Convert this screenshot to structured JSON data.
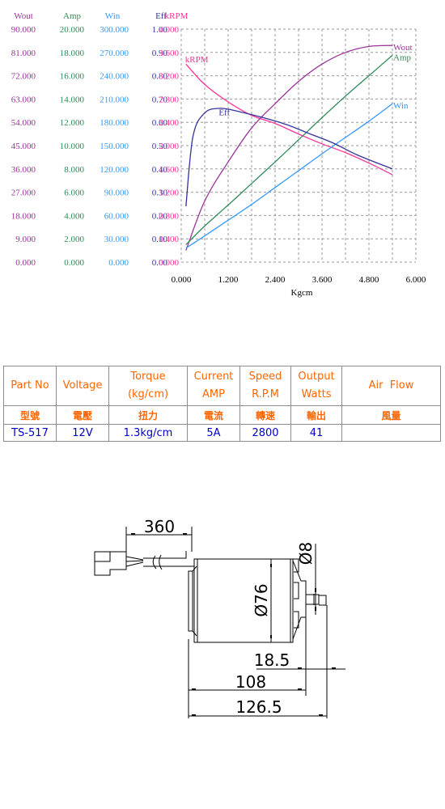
{
  "chart_data": {
    "type": "line",
    "title": "",
    "xlabel": "Kgcm",
    "x_ticks": [
      "0.000",
      "1.200",
      "2.400",
      "3.600",
      "4.800",
      "6.000"
    ],
    "xlim": [
      0,
      6
    ],
    "grid": true,
    "axes": [
      {
        "name": "Wout",
        "color": "#993399",
        "range": [
          0,
          90
        ],
        "ticks": [
          "90.000",
          "81.000",
          "72.000",
          "63.000",
          "54.000",
          "45.000",
          "36.000",
          "27.000",
          "18.000",
          "9.000",
          "0.000"
        ]
      },
      {
        "name": "Amp",
        "color": "#2e8b57",
        "range": [
          0,
          20
        ],
        "ticks": [
          "20.000",
          "18.000",
          "16.000",
          "14.000",
          "12.000",
          "10.000",
          "8.000",
          "6.000",
          "4.000",
          "2.000",
          "0.000"
        ]
      },
      {
        "name": "Win",
        "color": "#3399ff",
        "range": [
          0,
          300
        ],
        "ticks": [
          "300.000",
          "270.000",
          "240.000",
          "210.000",
          "180.000",
          "150.000",
          "120.000",
          "90.000",
          "60.000",
          "30.000",
          "0.000"
        ]
      },
      {
        "name": "Eff",
        "color": "#333399",
        "range": [
          0,
          1
        ],
        "ticks": [
          "1.00",
          "0.90",
          "0.80",
          "0.70",
          "0.60",
          "0.50",
          "0.40",
          "0.30",
          "0.20",
          "0.10",
          "0.00"
        ]
      },
      {
        "name": "kRPM",
        "color": "#ff3399",
        "range": [
          0,
          4
        ],
        "ticks": [
          "4.000",
          "3.600",
          "3.200",
          "2.800",
          "2.400",
          "2.000",
          "1.600",
          "1.200",
          "0.800",
          "0.400",
          "0.000"
        ]
      }
    ],
    "series": [
      {
        "name": "kRPM",
        "label": "kRPM",
        "label_pos": "start",
        "axis": "kRPM",
        "color": "#ff3399",
        "x": [
          0.12,
          0.6,
          1.2,
          1.8,
          2.4,
          3.0,
          3.6,
          4.2,
          4.8,
          5.4
        ],
        "y": [
          3.4,
          3.05,
          2.75,
          2.52,
          2.38,
          2.2,
          2.03,
          1.88,
          1.7,
          1.5
        ]
      },
      {
        "name": "Wout",
        "label": "Wout",
        "label_pos": "end",
        "axis": "Wout",
        "color": "#993399",
        "x": [
          0.12,
          0.6,
          1.2,
          1.8,
          2.4,
          3.0,
          3.6,
          4.2,
          4.8,
          5.4
        ],
        "y": [
          4.5,
          23.6,
          38.7,
          51.8,
          61.2,
          69.8,
          76.5,
          81.0,
          83.3,
          83.7
        ]
      },
      {
        "name": "Amp",
        "label": "Amp",
        "label_pos": "end",
        "axis": "Amp",
        "color": "#2e8b57",
        "x": [
          0.12,
          0.6,
          1.2,
          1.8,
          2.4,
          3.0,
          3.6,
          4.2,
          4.8,
          5.4
        ],
        "y": [
          1.5,
          3.1,
          4.9,
          6.75,
          8.6,
          10.5,
          12.4,
          14.25,
          16.0,
          17.75
        ]
      },
      {
        "name": "Win",
        "label": "Win",
        "label_pos": "end",
        "axis": "Win",
        "color": "#3399ff",
        "x": [
          0.12,
          0.6,
          1.2,
          1.8,
          2.4,
          3.0,
          3.6,
          4.2,
          4.8,
          5.4
        ],
        "y": [
          18,
          33.75,
          54,
          74.25,
          96,
          117.75,
          139.5,
          160.5,
          181.5,
          204
        ]
      },
      {
        "name": "Eff",
        "label": "Eff",
        "label_pos": "peak",
        "axis": "Eff",
        "color": "#333399",
        "x": [
          0.12,
          0.3,
          0.6,
          1.0,
          1.5,
          2.1,
          2.7,
          3.3,
          3.9,
          4.5,
          5.4
        ],
        "y": [
          0.24,
          0.54,
          0.64,
          0.66,
          0.645,
          0.62,
          0.59,
          0.55,
          0.51,
          0.46,
          0.4
        ]
      }
    ]
  },
  "spec_table": {
    "headers": [
      {
        "line1": "Part No",
        "line2": ""
      },
      {
        "line1": "Voltage",
        "line2": ""
      },
      {
        "line1": "Torque",
        "line2": "(kg/cm)"
      },
      {
        "line1": "Current",
        "line2": "AMP"
      },
      {
        "line1": "Speed",
        "line2": "R.P.M"
      },
      {
        "line1": "Output",
        "line2": "Watts"
      },
      {
        "line1": "Air  Flow",
        "line2": ""
      }
    ],
    "zh_headers": [
      "型號",
      "電壓",
      "扭力",
      "電流",
      "轉速",
      "輸出",
      "風量"
    ],
    "values": [
      "TS-517",
      "12V",
      "1.3kg/cm",
      "5A",
      "2800",
      "41",
      ""
    ]
  },
  "drawing": {
    "dim_cable": "360",
    "dim_diameter": "Ø76",
    "dim_shaft": "Ø8",
    "dim_shaft_len": "18.5",
    "dim_body": "108",
    "dim_total": "126.5"
  }
}
